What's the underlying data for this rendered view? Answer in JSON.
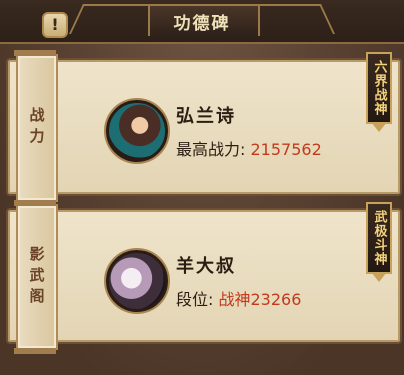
{
  "header": {
    "title": "功德碑",
    "info_symbol": "!"
  },
  "cards": [
    {
      "tab_label": "战力",
      "name": "弘兰诗",
      "stat_label": "最高战力: ",
      "stat_value": "2157562",
      "rank_badge": "六界战神"
    },
    {
      "tab_label": "影武阁",
      "name": "羊大叔",
      "stat_label": "段位: ",
      "stat_value": "战神23266",
      "rank_badge": "武极斗神"
    }
  ],
  "colors": {
    "value_red": "#c23a1c",
    "badge_gold": "#f2d27a"
  }
}
